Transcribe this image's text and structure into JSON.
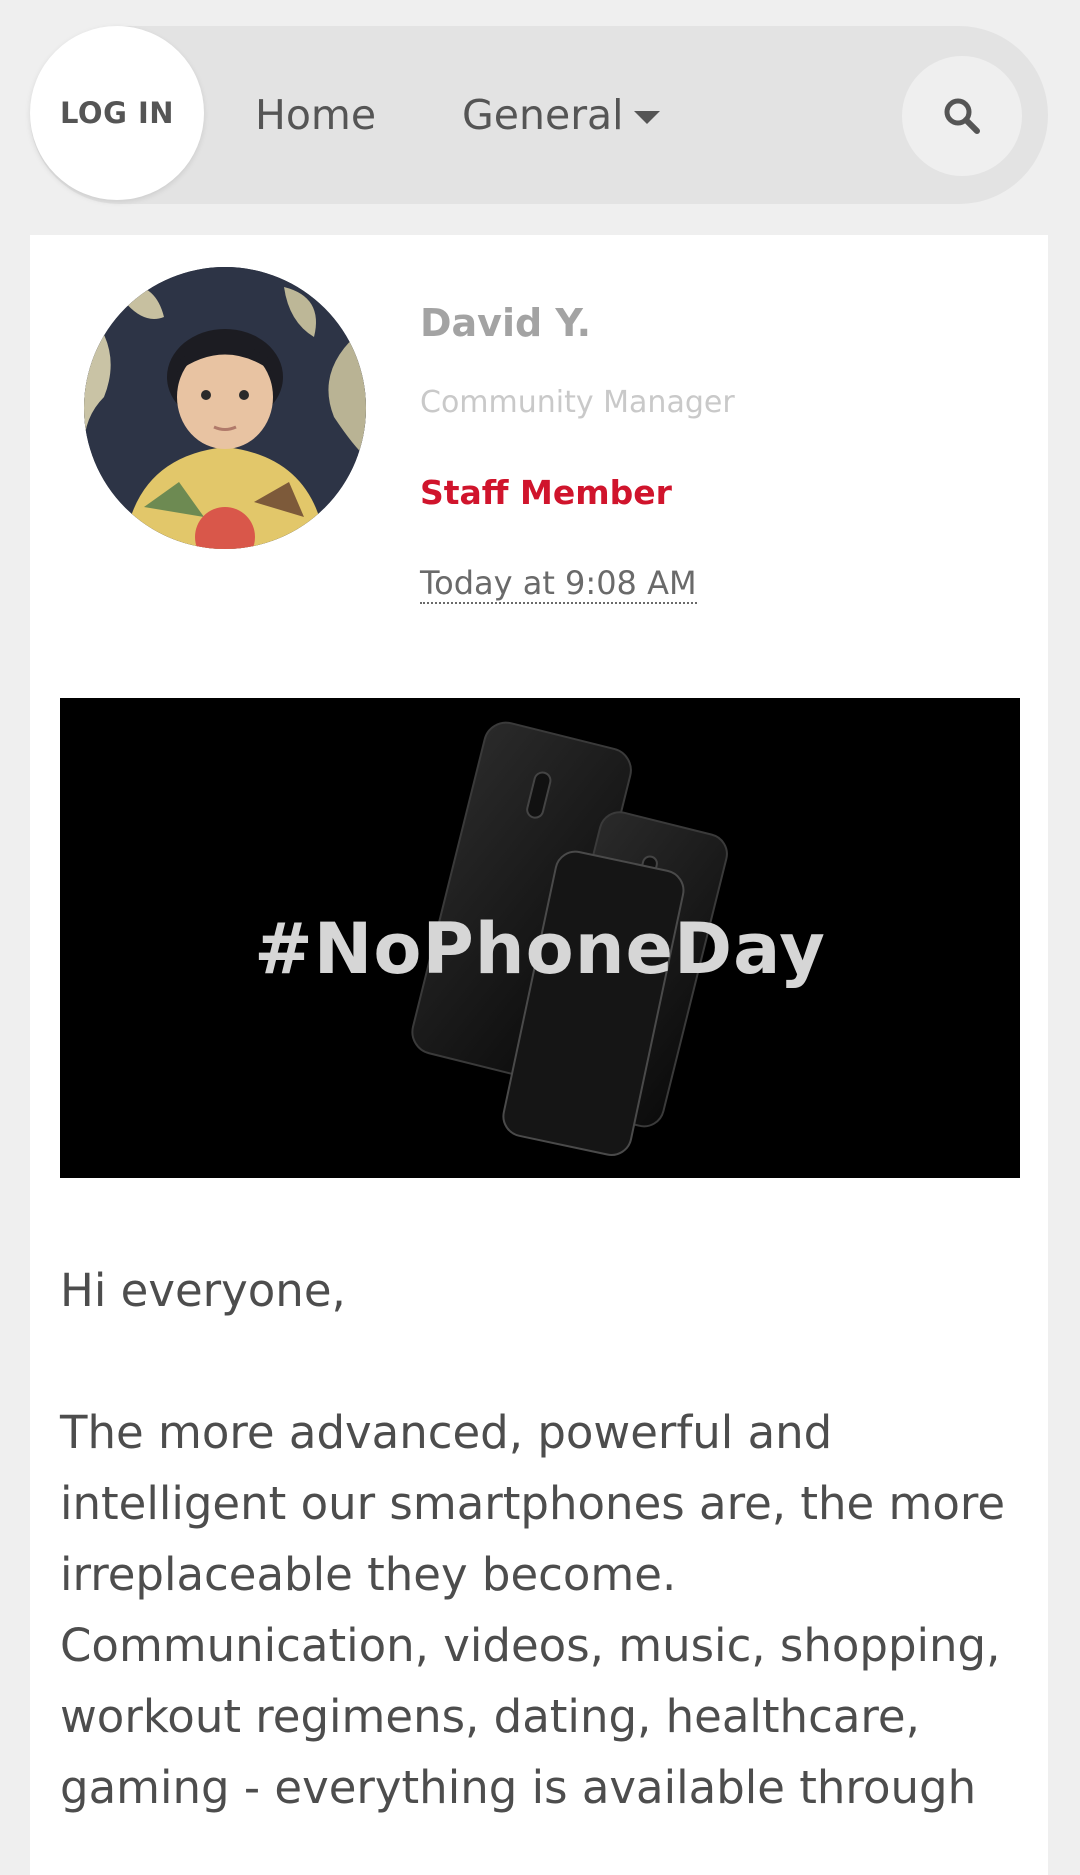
{
  "nav": {
    "login_label": "LOG IN",
    "home_label": "Home",
    "general_label": "General"
  },
  "post": {
    "author": {
      "name": "David Y.",
      "title": "Community Manager",
      "badge": "Staff Member"
    },
    "timestamp": "Today at 9:08 AM",
    "banner_text": "#NoPhoneDay",
    "greeting": "Hi everyone,",
    "paragraph": "The more advanced, powerful and intelligent our smartphones are, the more irreplaceable they become. Communication, videos, music, shopping, workout regimens, dating, healthcare, gaming - everything is available through"
  },
  "colors": {
    "page_bg": "#efefef",
    "nav_bg": "#e3e3e3",
    "staff_red": "#d0142c",
    "banner_bg": "#000000"
  },
  "icons": {
    "search": "search-icon",
    "dropdown": "caret-down-icon"
  }
}
